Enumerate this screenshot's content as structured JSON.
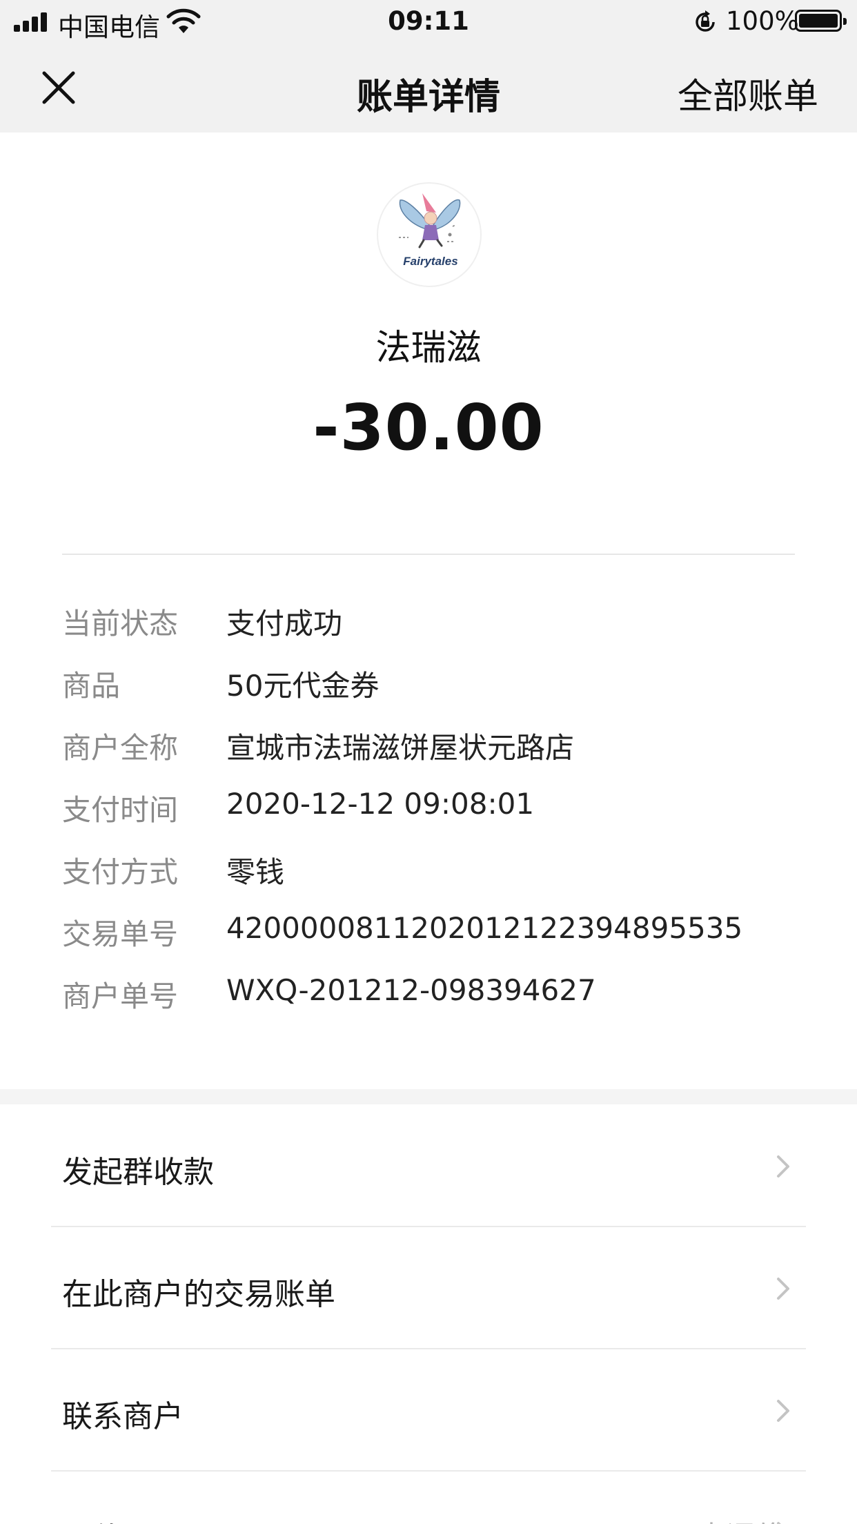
{
  "status_bar": {
    "carrier": "中国电信",
    "time": "09:11",
    "battery": "100%",
    "icons": [
      "signal-icon",
      "wifi-icon",
      "rotation-lock-icon",
      "battery-icon"
    ]
  },
  "nav": {
    "title": "账单详情",
    "right_link": "全部账单",
    "close_icon": "close-icon"
  },
  "merchant": {
    "logo_text": "Fairytales",
    "name": "法瑞滋",
    "amount": "-30.00"
  },
  "details": [
    {
      "label": "当前状态",
      "value": "支付成功"
    },
    {
      "label": "商品",
      "value": "50元代金券"
    },
    {
      "label": "商户全称",
      "value": "宣城市法瑞滋饼屋状元路店"
    },
    {
      "label": "支付时间",
      "value": "2020-12-12 09:08:01"
    },
    {
      "label": "支付方式",
      "value": "零钱"
    },
    {
      "label": "交易单号",
      "value": "4200000811202012122394895535"
    },
    {
      "label": "商户单号",
      "value": "WXQ-201212-098394627"
    }
  ],
  "actions": [
    {
      "label": "发起群收款"
    },
    {
      "label": "在此商户的交易账单"
    },
    {
      "label": "联系商户"
    },
    {
      "label": "评价",
      "sub": "去评价"
    }
  ],
  "colors": {
    "nav_bg": "#f1f1f1",
    "label": "#8a8a8a",
    "chevron": "#c4c4c4"
  }
}
